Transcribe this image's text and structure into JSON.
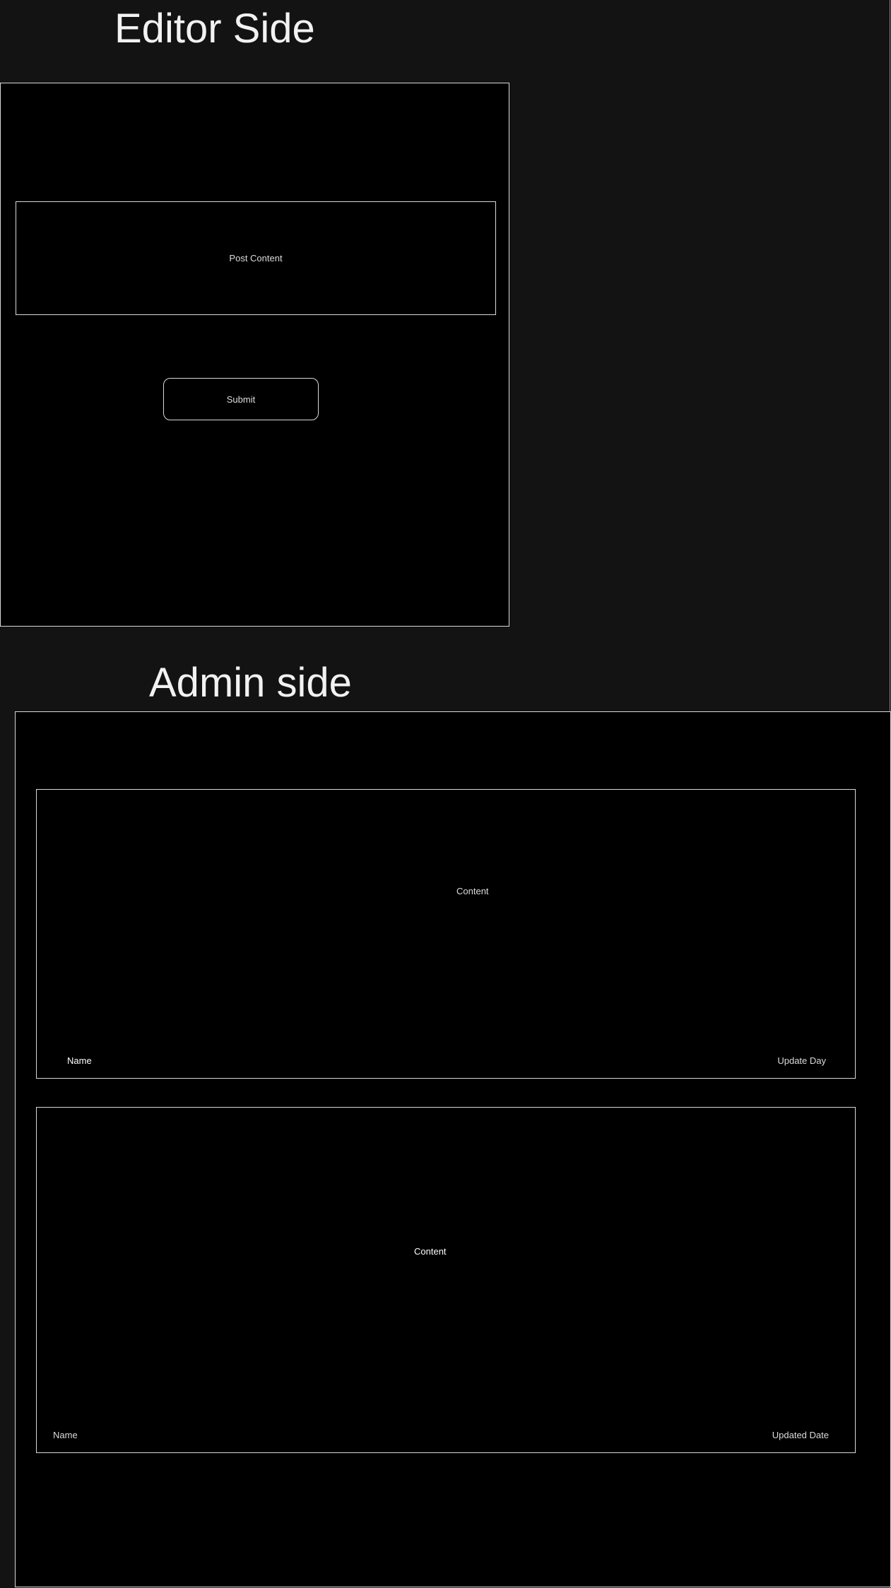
{
  "editor": {
    "title": "Editor Side",
    "post_content_label": "Post Content",
    "submit_label": "Submit"
  },
  "admin": {
    "title": "Admin side",
    "posts": [
      {
        "content": "Content",
        "name": "Name",
        "date_label": "Update Day"
      },
      {
        "content": "Content",
        "name": "Name",
        "date_label": "Updated Date"
      }
    ]
  },
  "colors": {
    "page_background": "#131313",
    "panel_background": "#000000",
    "border": "#d9d9d9",
    "text": "#dcdcdc"
  }
}
